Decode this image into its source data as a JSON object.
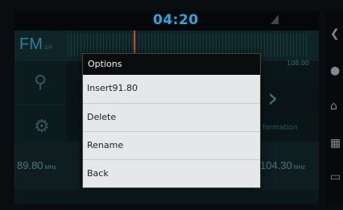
{
  "status": {
    "time": "04:20"
  },
  "radio": {
    "band": "FM",
    "band_sub": "1/4",
    "right_freq": "108.00",
    "info_label": "formation",
    "presets": [
      {
        "freq": "89.80",
        "unit": "MHz"
      },
      {
        "freq": "104.30",
        "unit": "MHz"
      }
    ]
  },
  "dialog": {
    "title": "Options",
    "options": [
      "Insert91.80",
      "Delete",
      "Rename",
      "Back"
    ]
  },
  "icons": {
    "search": "search-icon",
    "settings": "gear-icon",
    "next": "chevron-right-icon",
    "right_bar": [
      "back-icon",
      "mic-icon",
      "home-icon",
      "apps-icon",
      "recent-icon"
    ]
  }
}
